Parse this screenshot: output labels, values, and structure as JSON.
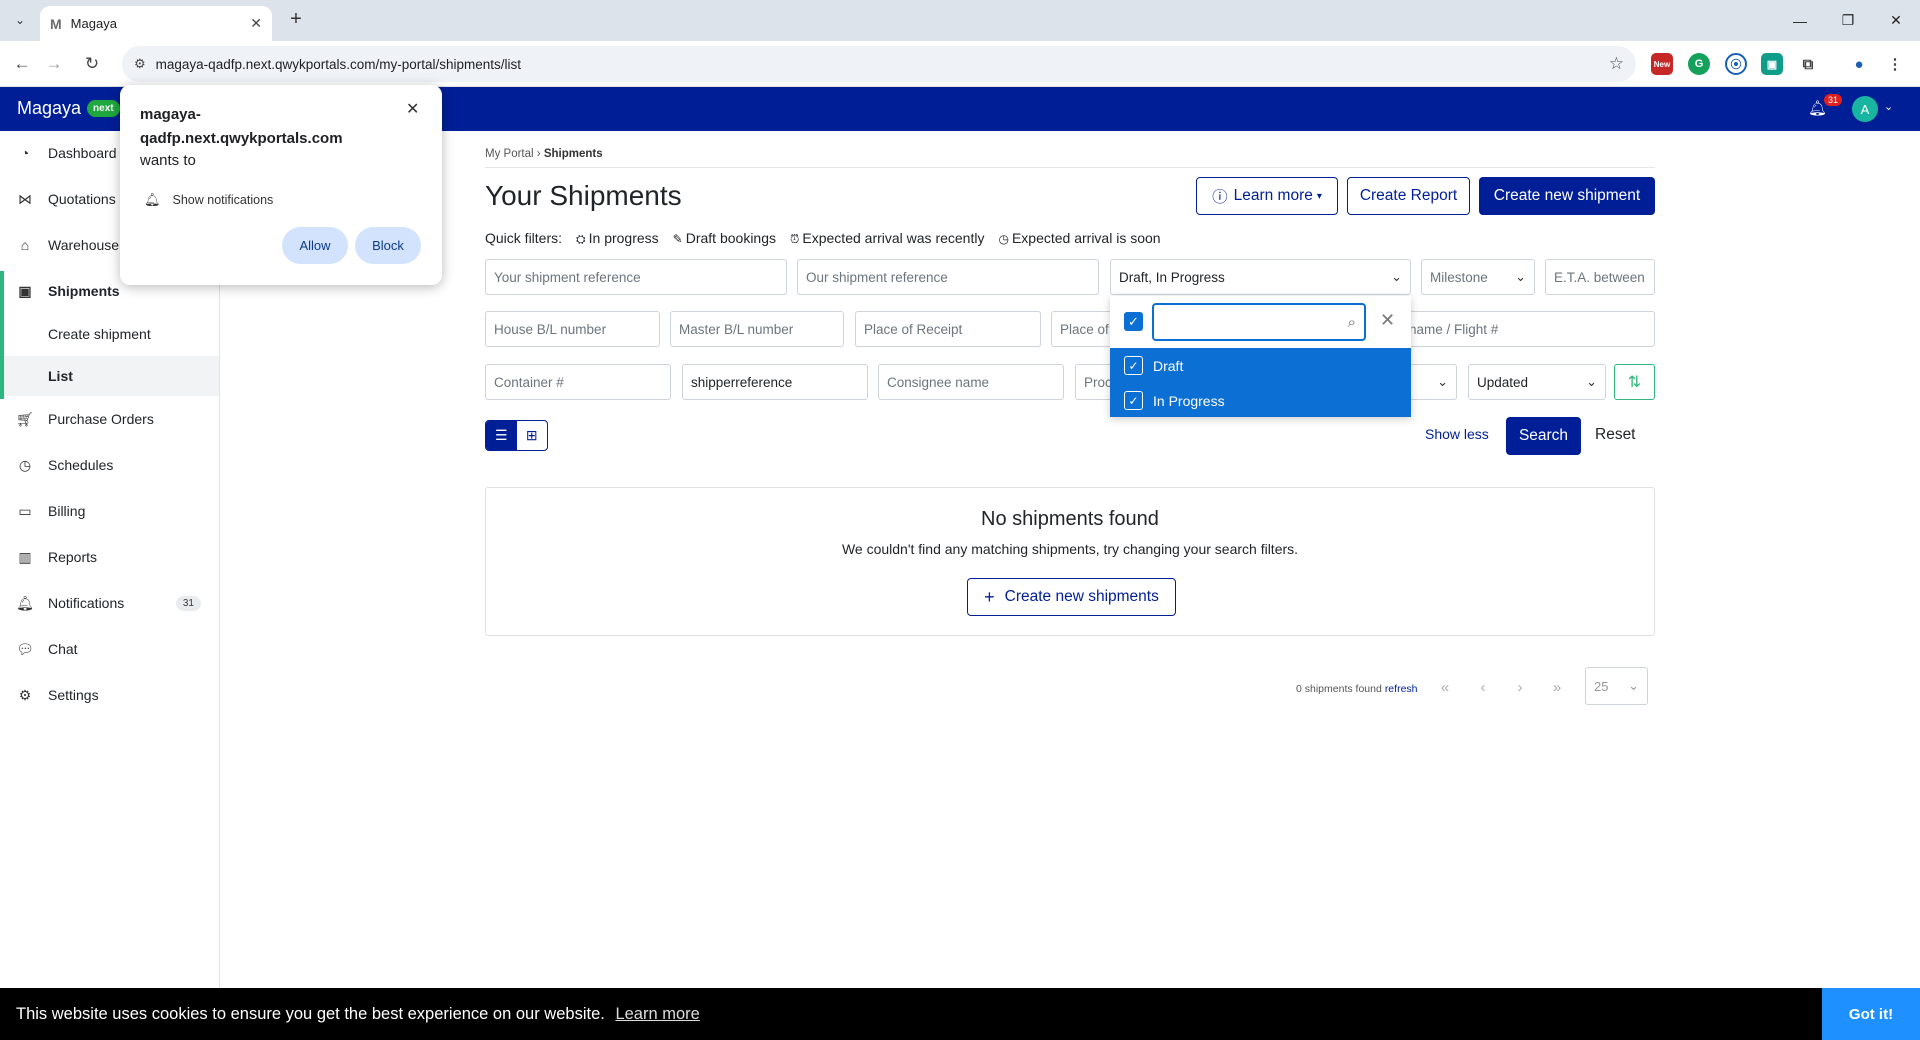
{
  "browser": {
    "tab_title": "Magaya",
    "tab_favicon": "M",
    "url": "magaya-qadfp.next.qwykportals.com/my-portal/shipments/list",
    "ext_new_label": "New"
  },
  "app": {
    "brand": "Magaya",
    "brand_badge": "next",
    "notif_count": "31",
    "avatar_initial": "A"
  },
  "sidebar": {
    "items": [
      {
        "label": "Dashboard"
      },
      {
        "label": "Quotations"
      },
      {
        "label": "Warehouse"
      },
      {
        "label": "Shipments"
      },
      {
        "label": "Create shipment"
      },
      {
        "label": "List"
      },
      {
        "label": "Purchase Orders"
      },
      {
        "label": "Schedules"
      },
      {
        "label": "Billing"
      },
      {
        "label": "Reports"
      },
      {
        "label": "Notifications",
        "badge": "31"
      },
      {
        "label": "Chat"
      },
      {
        "label": "Settings"
      }
    ]
  },
  "breadcrumb": {
    "root": "My Portal",
    "sep": "›",
    "current": "Shipments"
  },
  "page": {
    "title": "Your Shipments",
    "learn_more": "Learn more",
    "create_report": "Create Report",
    "create_new": "Create new shipment"
  },
  "quick_filters": {
    "label": "Quick filters:",
    "items": [
      "In progress",
      "Draft bookings",
      "Expected arrival was recently",
      "Expected arrival is soon"
    ]
  },
  "filters": {
    "row1": {
      "your_ref": "Your shipment reference",
      "our_ref": "Our shipment reference",
      "status_value": "Draft, In Progress",
      "milestone": "Milestone",
      "eta": "E.T.A. between"
    },
    "row2": {
      "house_bl": "House B/L number",
      "master_bl": "Master B/L number",
      "place_receipt": "Place of Receipt",
      "place_of": "Place of",
      "vessel": "name / Flight #"
    },
    "row3": {
      "container": "Container #",
      "shipper_ref_value": "shipperreference",
      "consignee": "Consignee name",
      "proc": "Proc",
      "sort_value": "Updated"
    }
  },
  "actions": {
    "show_less": "Show less",
    "search": "Search",
    "reset": "Reset"
  },
  "dropdown": {
    "search_value": "",
    "options": [
      {
        "label": "Draft",
        "checked": true
      },
      {
        "label": "In Progress",
        "checked": true
      }
    ]
  },
  "empty": {
    "title": "No shipments found",
    "subtitle": "We couldn't find any matching shipments, try changing your search filters.",
    "button": "Create new shipments"
  },
  "pagination": {
    "count_text": "0 shipments found",
    "refresh": "refresh",
    "page_size": "25"
  },
  "permission_popup": {
    "host": "magaya-qadfp.next.qwykportals.com",
    "wants_to": "wants to",
    "request": "Show notifications",
    "allow": "Allow",
    "block": "Block"
  },
  "cookie": {
    "text": "This website uses cookies to ensure you get the best experience on our website.",
    "learn_more": "Learn more",
    "button": "Got it!"
  },
  "colors": {
    "brand_navy": "#001e96",
    "accent_green": "#2fb67e",
    "dropdown_blue": "#0b6fd4"
  }
}
